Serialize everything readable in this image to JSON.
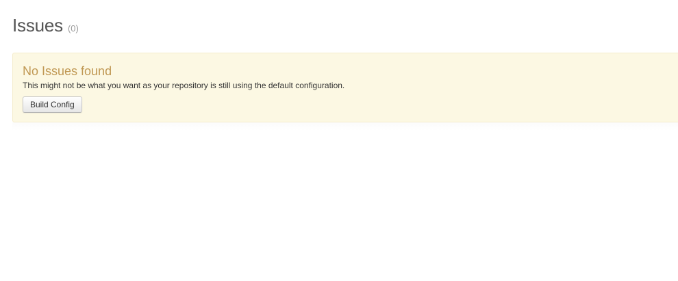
{
  "header": {
    "title": "Issues",
    "count": "(0)"
  },
  "notice": {
    "title": "No Issues found",
    "message": "This might not be what you want as your repository is still using the default configuration.",
    "button_label": "Build Config"
  },
  "colors": {
    "notice_background": "#fcf8e3",
    "notice_title": "#c09853"
  }
}
